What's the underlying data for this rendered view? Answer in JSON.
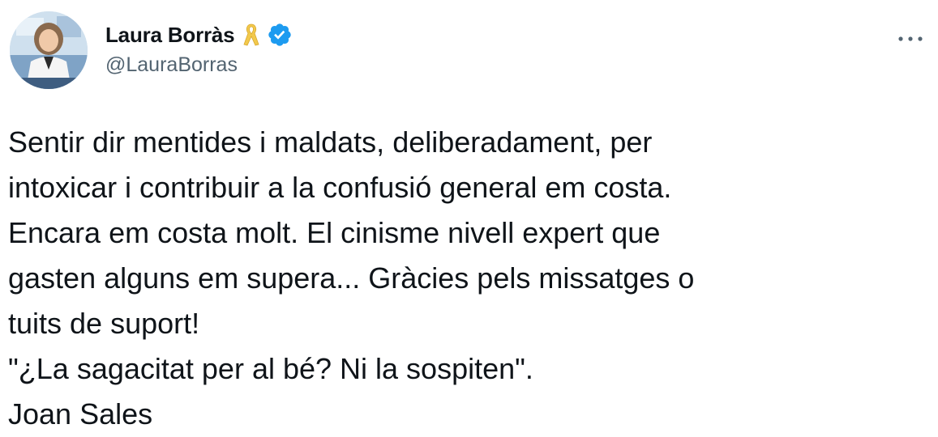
{
  "tweet": {
    "author": {
      "display_name": "Laura Borràs",
      "handle": "@LauraBorras",
      "badges": [
        "yellow-ribbon-icon",
        "verified-badge-icon"
      ]
    },
    "menu_icon": "more-horizontal-icon",
    "text": "Sentir dir mentides i maldats, deliberadament, per\nintoxicar i contribuir a la confusió general em costa.\nEncara em costa molt. El cinisme nivell expert que\ngasten alguns em supera... Gràcies pels missatges o\ntuits de suport!\n\"¿La sagacitat per al bé? Ni la sospiten\".\nJoan Sales",
    "colors": {
      "verified": "#1d9bf0",
      "ribbon": "#f2c94c",
      "secondary_text": "#536471",
      "primary_text": "#0f1419"
    }
  }
}
